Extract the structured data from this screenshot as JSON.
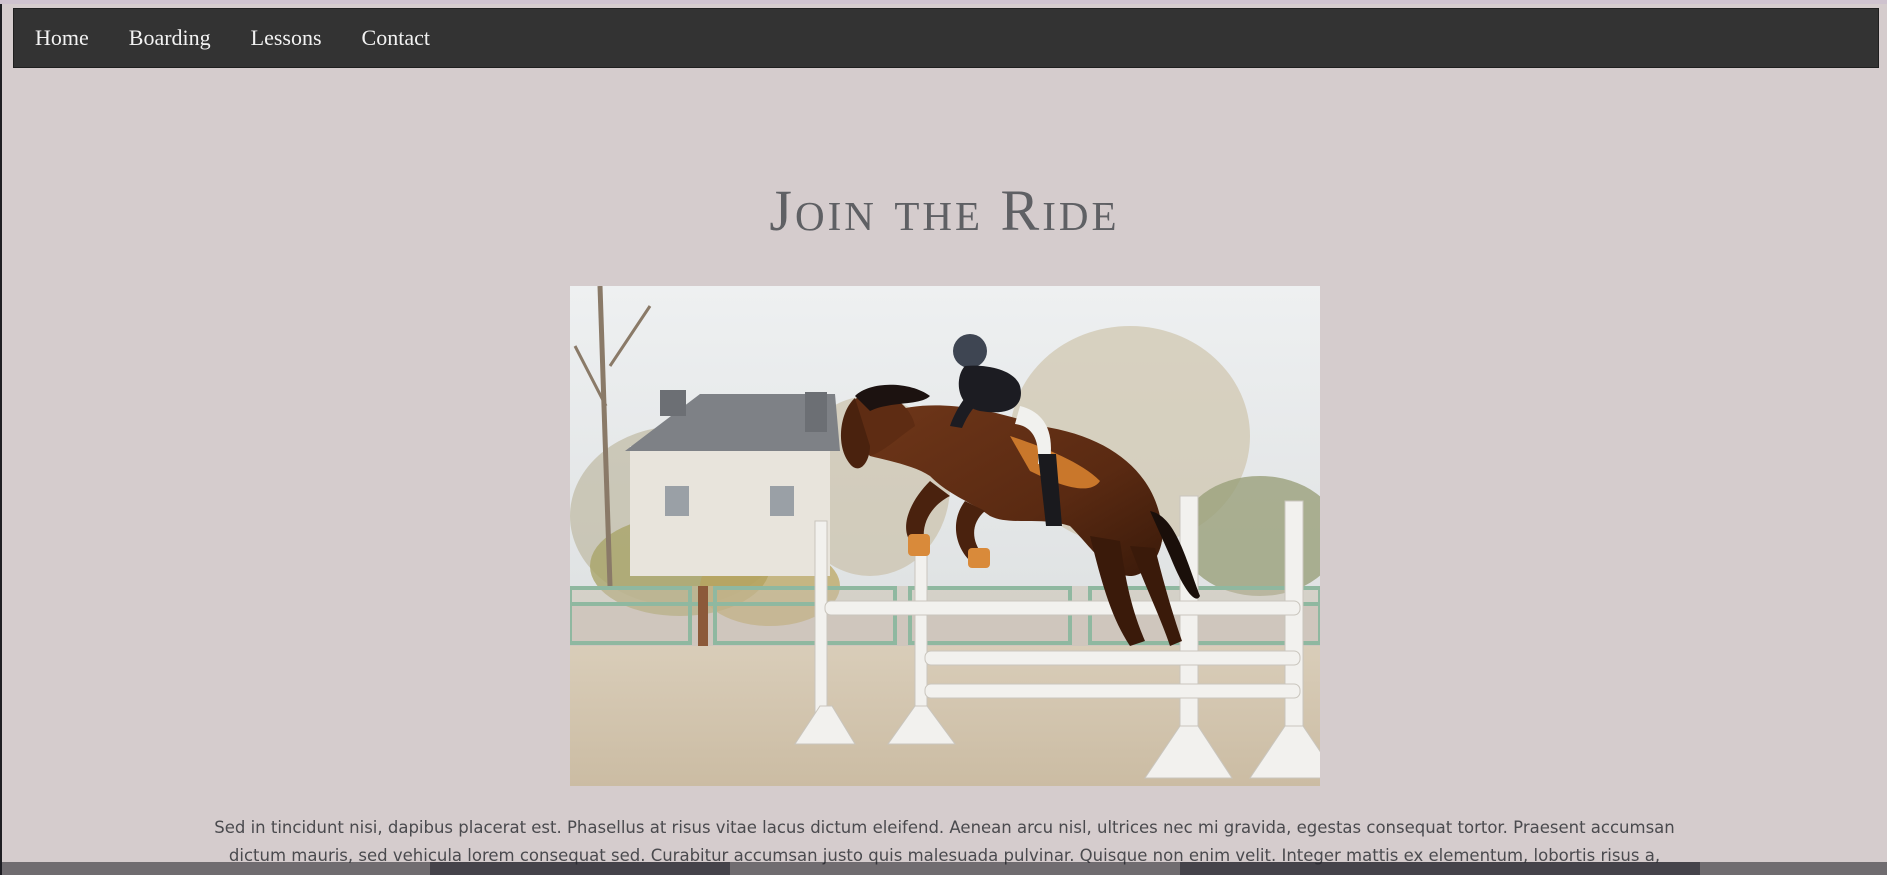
{
  "nav": {
    "items": [
      {
        "label": "Home"
      },
      {
        "label": "Boarding"
      },
      {
        "label": "Lessons"
      },
      {
        "label": "Contact"
      }
    ]
  },
  "main": {
    "heading": "Join the Ride",
    "image_alt": "horse-jumping-photo",
    "paragraph": "Sed in tincidunt nisi, dapibus placerat est. Phasellus at risus vitae lacus dictum eleifend. Aenean arcu nisl, ultrices nec mi gravida, egestas consequat tortor. Praesent accumsan dictum mauris, sed vehicula lorem consequat sed. Curabitur accumsan justo quis malesuada pulvinar. Quisque non enim velit. Integer mattis ex elementum, lobortis risus a, laoreet tortor. Nam ut massa ut metus"
  },
  "colors": {
    "page_background": "#d5cccd",
    "navbar": "#333333",
    "nav_text": "#f2f2f2",
    "heading": "#5f6064",
    "body_text": "#4a4a4e"
  }
}
